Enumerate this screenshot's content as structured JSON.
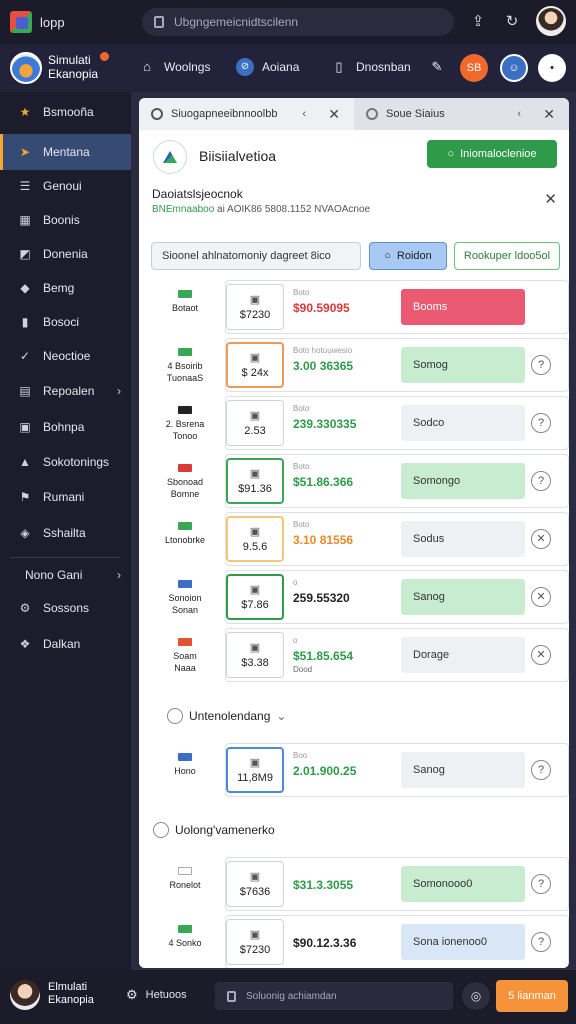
{
  "os": {
    "app_name": "lopp",
    "search_text": "Ubgngemeicnidtscilenn"
  },
  "header": {
    "brand_line1": "Simulati",
    "brand_line2": "Ekanopia",
    "nav": [
      {
        "label": "Woolngs",
        "icon": "bag-icon"
      },
      {
        "label": "Aoiana",
        "icon": "compass-icon"
      },
      {
        "label": "Dnosnban",
        "icon": "document-icon"
      }
    ],
    "orange_badge": "SB"
  },
  "sidebar": {
    "items": [
      {
        "label": "Bsmooña",
        "icon": "star-icon"
      },
      {
        "label": "Mentana",
        "icon": "send-icon"
      },
      {
        "label": "Genoui",
        "icon": "list-icon"
      },
      {
        "label": "Boonis",
        "icon": "grid-icon"
      },
      {
        "label": "Donenia",
        "icon": "chart-icon"
      },
      {
        "label": "Bemg",
        "icon": "car-icon"
      },
      {
        "label": "Bosoci",
        "icon": "book-icon"
      },
      {
        "label": "Neoctioe",
        "icon": "tag-icon"
      },
      {
        "label": "Repoalen",
        "icon": "report-icon"
      },
      {
        "label": "Bohnpa",
        "icon": "page-icon"
      },
      {
        "label": "Sokotonings",
        "icon": "triangle-icon"
      },
      {
        "label": "Rumani",
        "icon": "users-icon"
      },
      {
        "label": "Sshailta",
        "icon": "cube-icon"
      }
    ],
    "group_label": "Nono Gani",
    "bottom_items": [
      {
        "label": "Sossons",
        "icon": "gear-icon"
      },
      {
        "label": "Dalkan",
        "icon": "cubes-icon"
      }
    ]
  },
  "tabs": [
    {
      "label": "Siuogapneeibnnoolbb"
    },
    {
      "label": "Soue Siaius"
    }
  ],
  "company": {
    "title": "Biisiialvetioa",
    "action_button": "Iniomaloclenioe",
    "subtitle": "Daoiatslsjeocnok",
    "detail_highlight": "BNEmnaaboo",
    "detail_rest": "ai AOIK86 5808.1152 NVAOAcnoe"
  },
  "filters": {
    "filter_text": "Sioonel ahlnatomoniy dagreet 8ico",
    "blue_button": "Roidon",
    "green_button": "Rookuper ldoo5ol"
  },
  "rows": [
    {
      "label": "Botaot",
      "price": "$7230",
      "small": "Boto",
      "value": "$90.59095",
      "value_color": "#d93a3a",
      "status": "Booms",
      "status_bg": "#ea5a72",
      "status_color": "#ffffff",
      "action": "+",
      "border": "#cfd3db",
      "mini": "#3aa757"
    },
    {
      "label": "4  Bsoirib\nTuonaaS",
      "price": "$ 24x",
      "small": "Boto hotuuwesio",
      "value": "3.00 36365",
      "value_color": "#2e9a4a",
      "status": "Somog",
      "status_bg": "#c8ecd0",
      "status_color": "#333333",
      "action": "?",
      "border": "#f09a55",
      "mini": "#3aa757"
    },
    {
      "label": "2. Bsrena\nTonoo",
      "price": "2.53",
      "small": "Boto",
      "value": "239.330335",
      "value_color": "#2e9a4a",
      "status": "Sodco",
      "status_bg": "#eef0f4",
      "status_color": "#333333",
      "action": "?",
      "border": "#cfd3db",
      "mini": "#222222"
    },
    {
      "label": "Sbonoad\nBomne",
      "price": "$91.36",
      "small": "Boto",
      "value": "$51.86.366",
      "value_color": "#2e9a4a",
      "status": "Somongo",
      "status_bg": "#c8ecd0",
      "status_color": "#333333",
      "action": "?",
      "border": "#3aa757",
      "mini": "#d93a3a"
    },
    {
      "label": "Ltonobrke",
      "price": "9.5.6",
      "small": "Boto",
      "value": "3.10 81556",
      "value_color": "#e88a2a",
      "status": "Sodus",
      "status_bg": "#eef0f4",
      "status_color": "#333333",
      "action": "x",
      "border": "#f0c878",
      "mini": "#3aa757"
    },
    {
      "label": "Sonoion\nSonan",
      "price": "$7.86",
      "small": "o",
      "value": "259.55320",
      "value_color": "#222222",
      "status": "Sanog",
      "status_bg": "#c8ecd0",
      "status_color": "#333333",
      "action": "x",
      "border": "#2e9a4a",
      "mini": "#3a6fc4"
    },
    {
      "label": "Soam\nNaaa",
      "price": "$3.38",
      "small": "o",
      "value": "$51.85.654",
      "value_color": "#2e9a4a",
      "value_sub": "Dood",
      "status": "Dorage",
      "status_bg": "#eef0f4",
      "status_color": "#333333",
      "action": "x",
      "border": "#cfd3db",
      "mini": "#e0552e"
    }
  ],
  "section1": {
    "title": "Untenolendang",
    "rows": [
      {
        "label": "Hono",
        "price": "11,8M9",
        "small": "Boo",
        "value": "2.01.900.25",
        "value_color": "#2e9a4a",
        "status": "Sanog",
        "status_bg": "#eef0f4",
        "status_color": "#333333",
        "action": "?",
        "border": "#4a8ad8",
        "mini": "#3a6fc4"
      }
    ]
  },
  "section2": {
    "title": "Uolong'vamenerko",
    "rows": [
      {
        "label": "Ronelot",
        "price": "$7636",
        "small": "",
        "value": "$31.3.3055",
        "value_color": "#2e9a4a",
        "status": "Somonooo0",
        "status_bg": "#c8ecd0",
        "status_color": "#333333",
        "action": "?",
        "border": "#cfd3db",
        "mini": "#ffffff"
      },
      {
        "label": "4  Sonko",
        "price": "$7230",
        "small": "",
        "value": "$90.12.3.36",
        "value_color": "#222222",
        "status": "Sona ionenoo0",
        "status_bg": "#d8e6f6",
        "status_color": "#333333",
        "action": "?",
        "border": "#cfd3db",
        "mini": "#3aa757"
      }
    ]
  },
  "bottombar": {
    "brand_line1": "Elmulati",
    "brand_line2": "Ekanopia",
    "nav_label": "Hetuoos",
    "search_text": "Soluonig achiamdan",
    "button": "5 lianman"
  }
}
